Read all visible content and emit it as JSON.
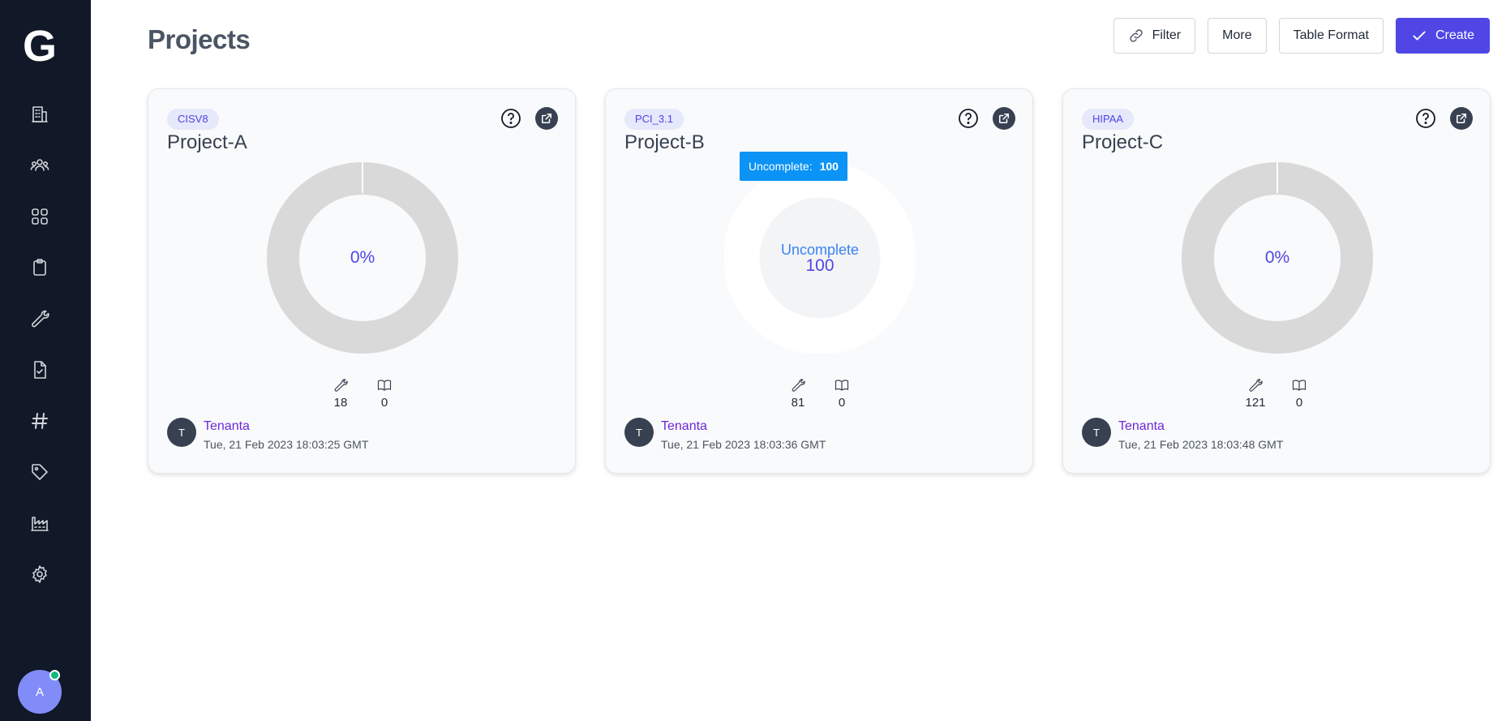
{
  "app": {
    "logo": "G"
  },
  "sidebar": {
    "items": [
      {
        "icon": "building-icon"
      },
      {
        "icon": "users-icon"
      },
      {
        "icon": "grid-icon"
      },
      {
        "icon": "clipboard-icon"
      },
      {
        "icon": "wrench-icon"
      },
      {
        "icon": "document-check-icon"
      },
      {
        "icon": "hashtag-icon"
      },
      {
        "icon": "tag-icon"
      },
      {
        "icon": "factory-icon"
      },
      {
        "icon": "gear-icon"
      }
    ],
    "user_initial": "A",
    "online_color": "#10b981"
  },
  "header": {
    "title": "Projects",
    "filter_label": "Filter",
    "more_label": "More",
    "table_format_label": "Table Format",
    "create_label": "Create"
  },
  "colors": {
    "sidebar_bg": "#111827",
    "accent": "#4f46e5",
    "donut_empty": "#d9d9d9",
    "tooltip_bg": "#0b93f6"
  },
  "projects": [
    {
      "badge": "CISV8",
      "name": "Project-A",
      "center_label": "0%",
      "remediations": "18",
      "policies": "0",
      "owner_initial": "T",
      "owner": "Tenanta",
      "date": "Tue, 21 Feb 2023 18:03:25 GMT"
    },
    {
      "badge": "PCI_3.1",
      "name": "Project-B",
      "center_status": "Uncomplete",
      "center_value": "100",
      "tooltip_label": "Uncomplete:",
      "tooltip_value": "100",
      "remediations": "81",
      "policies": "0",
      "owner_initial": "T",
      "owner": "Tenanta",
      "date": "Tue, 21 Feb 2023 18:03:36 GMT"
    },
    {
      "badge": "HIPAA",
      "name": "Project-C",
      "center_label": "0%",
      "remediations": "121",
      "policies": "0",
      "owner_initial": "T",
      "owner": "Tenanta",
      "date": "Tue, 21 Feb 2023 18:03:48 GMT"
    }
  ]
}
